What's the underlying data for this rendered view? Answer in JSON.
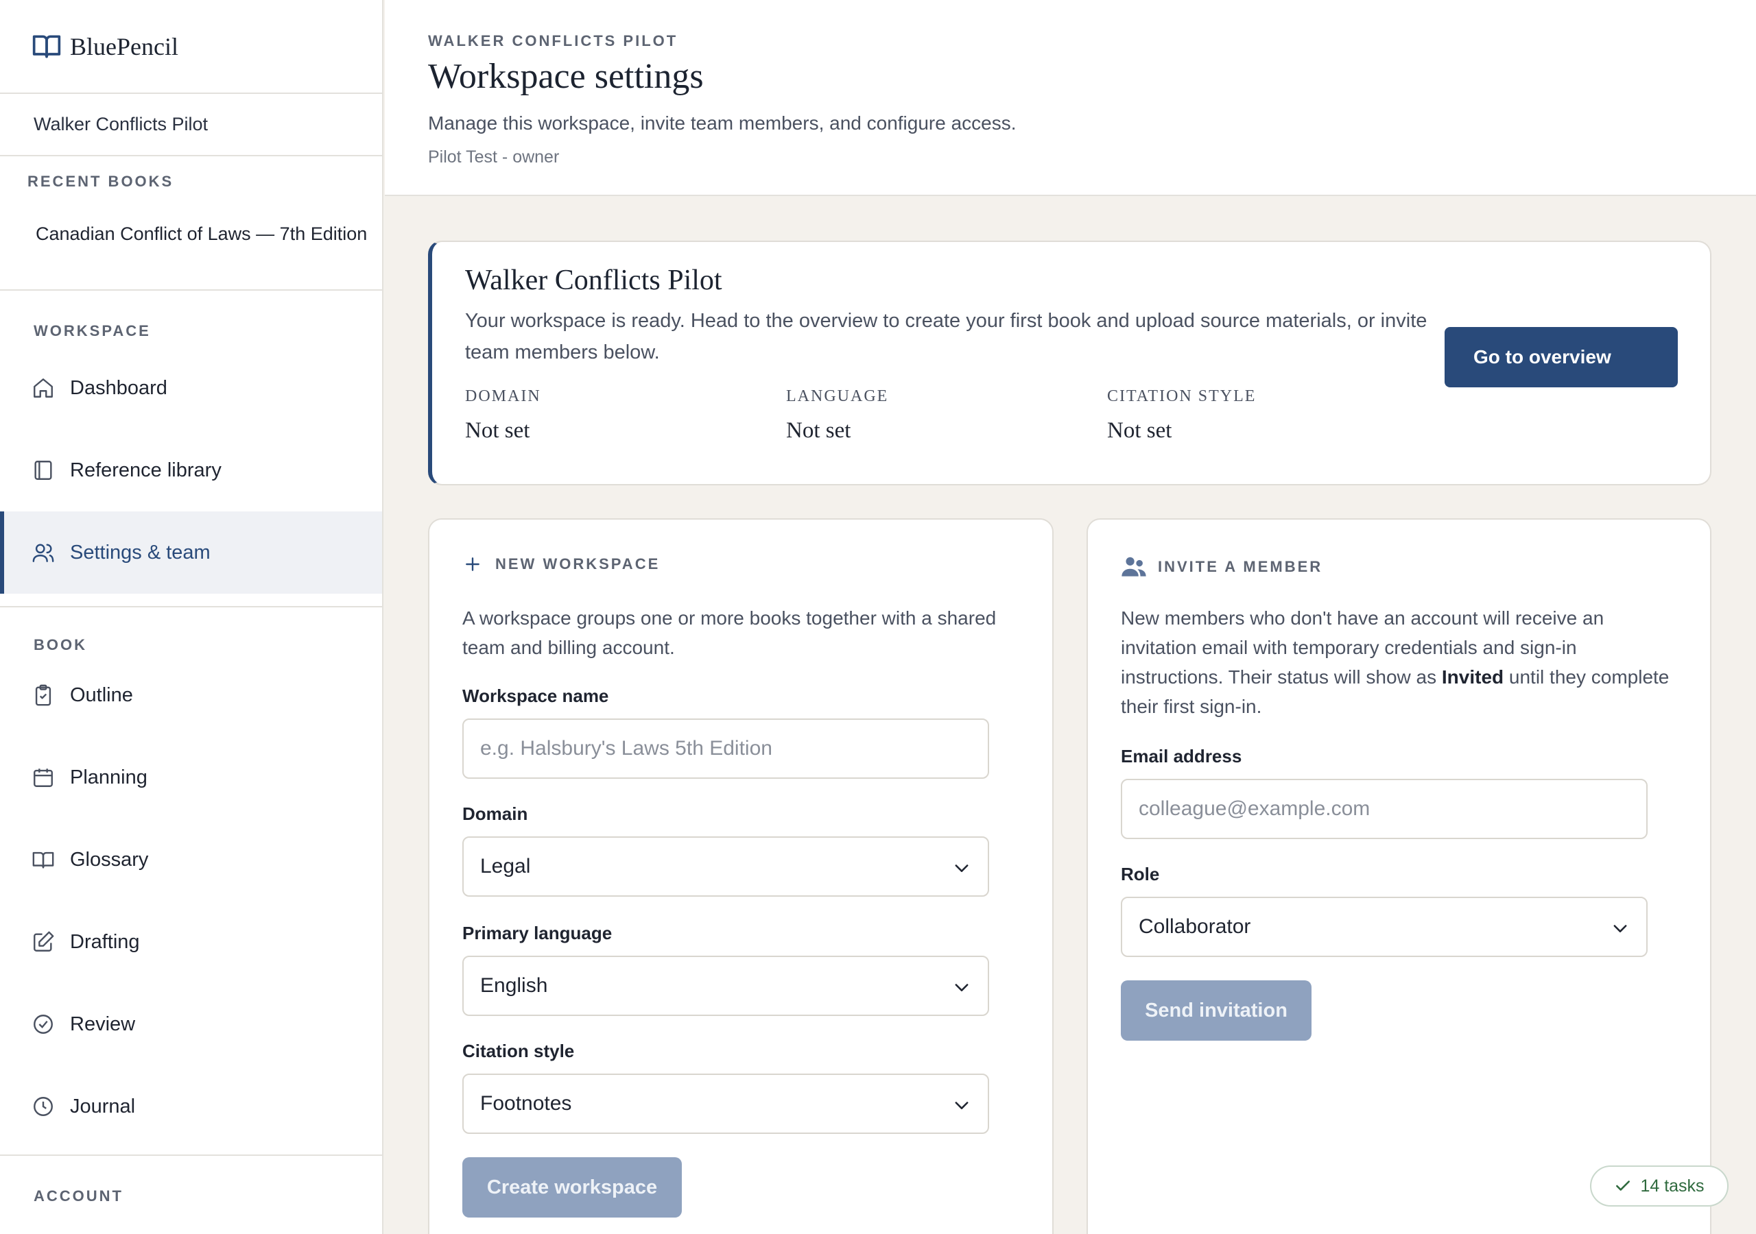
{
  "app": {
    "brand": "BluePencil"
  },
  "sidebar": {
    "workspace_name": "Walker Conflicts Pilot",
    "recent_label": "RECENT BOOKS",
    "recent_books": [
      "Canadian Conflict of Laws — 7th Edition"
    ],
    "workspace_section": {
      "label": "WORKSPACE",
      "items": [
        {
          "label": "Dashboard",
          "icon": "home-icon"
        },
        {
          "label": "Reference library",
          "icon": "book-icon"
        },
        {
          "label": "Settings & team",
          "icon": "users-icon",
          "active": true
        }
      ]
    },
    "book_section": {
      "label": "BOOK",
      "items": [
        {
          "label": "Outline",
          "icon": "clipboard-icon"
        },
        {
          "label": "Planning",
          "icon": "calendar-icon"
        },
        {
          "label": "Glossary",
          "icon": "open-book-icon"
        },
        {
          "label": "Drafting",
          "icon": "edit-icon"
        },
        {
          "label": "Review",
          "icon": "check-circle-icon"
        },
        {
          "label": "Journal",
          "icon": "clock-icon"
        }
      ]
    },
    "account_label": "ACCOUNT"
  },
  "header": {
    "eyebrow": "WALKER CONFLICTS PILOT",
    "title": "Workspace settings",
    "description": "Manage this workspace, invite team members, and configure access.",
    "meta": "Pilot Test - owner"
  },
  "summary": {
    "title": "Walker Conflicts Pilot",
    "text": "Your workspace is ready. Head to the overview to create your first book and upload source materials, or invite team members below.",
    "fields": [
      {
        "label": "Domain",
        "value": "Not set"
      },
      {
        "label": "Language",
        "value": "Not set"
      },
      {
        "label": "Citation style",
        "value": "Not set"
      }
    ],
    "button": "Go to overview"
  },
  "new_workspace": {
    "heading": "NEW WORKSPACE",
    "description": "A workspace groups one or more books together with a shared team and billing account.",
    "name_label": "Workspace name",
    "name_placeholder": "e.g. Halsbury's Laws 5th Edition",
    "domain_label": "Domain",
    "domain_value": "Legal",
    "language_label": "Primary language",
    "language_value": "English",
    "citation_label": "Citation style",
    "citation_value": "Footnotes",
    "button": "Create workspace"
  },
  "invite": {
    "heading": "INVITE A MEMBER",
    "description_pre": "New members who don't have an account will receive an invitation email with temporary credentials and sign-in instructions. Their status will show as ",
    "description_bold": "Invited",
    "description_post": " until they complete their first sign-in.",
    "email_label": "Email address",
    "email_placeholder": "colleague@example.com",
    "role_label": "Role",
    "role_value": "Collaborator",
    "button": "Send invitation"
  },
  "tasks_badge": "14 tasks",
  "colors": {
    "accent": "#294a7a",
    "disabled": "#8fa2bf",
    "background": "#f4f1ec",
    "success": "#2f6a3e"
  }
}
